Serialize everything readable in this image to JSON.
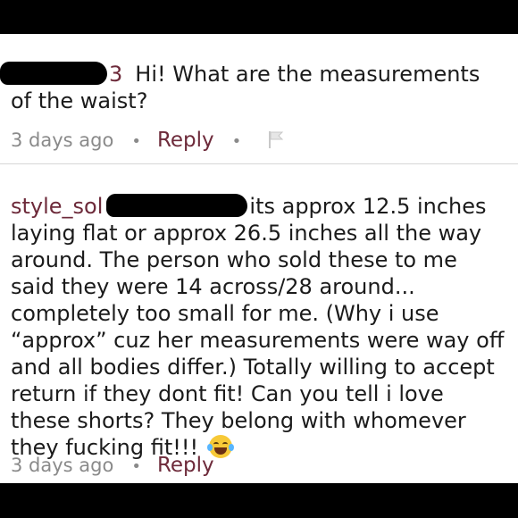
{
  "comments": [
    {
      "redacted_name_tail": "3",
      "text": "Hi! What are the measurements of the waist?",
      "time": "3 days ago",
      "reply": "Reply",
      "has_flag": true
    },
    {
      "username": "style_sol",
      "text": "its approx 12.5 inches laying flat or approx 26.5 inches all the way around. The person who sold these to me said they were 14 across/28 around... completely too small for me. (Why i  use “approx” cuz her measurements were way off and all bodies differ.) Totally willing to accept return if they dont fit! Can you tell i love these shorts? They belong with whomever they fucking fit!!!",
      "emoji": "face-with-tears-of-joy",
      "time": "3 days ago",
      "reply": "Reply"
    }
  ],
  "separator": "•",
  "colors": {
    "username": "#6d2a3a",
    "meta": "#8a8a8a",
    "text": "#1b1b1b",
    "frame": "#000000"
  }
}
